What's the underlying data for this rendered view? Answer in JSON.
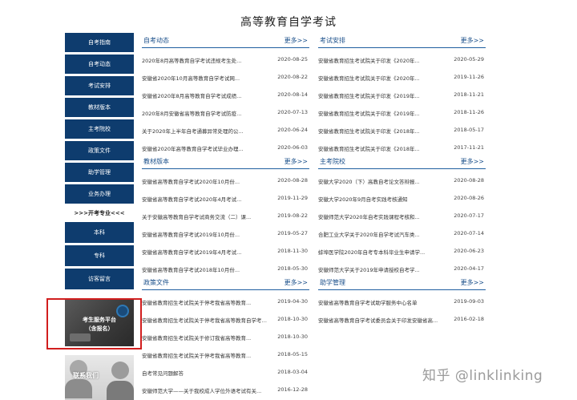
{
  "page": {
    "title": "高等教育自学考试"
  },
  "sidebar": {
    "items": [
      "自考指南",
      "自考动态",
      "考试安排",
      "教材版本",
      "主考院校",
      "政策文件",
      "助学管理",
      "业务办理"
    ],
    "heading": ">>>开考专业<<<",
    "items2": [
      "本科",
      "专科",
      "访客留言"
    ]
  },
  "promo": {
    "service_line1": "考生服务平台",
    "service_line2": "（含报名）",
    "contact": "联系我们"
  },
  "panels": {
    "dynamics": {
      "title": "自考动态",
      "more": "更多>>",
      "rows": [
        {
          "title": "2020年8月高等教育自学考试违规考生处...",
          "date": "2020-08-25"
        },
        {
          "title": "安徽省2020年10月高等教育自学考试网...",
          "date": "2020-08-22"
        },
        {
          "title": "安徽省2020年8月高等教育自学考试成绩...",
          "date": "2020-08-14"
        },
        {
          "title": "2020年8月安徽省高等教育自学考试防疫...",
          "date": "2020-07-13"
        },
        {
          "title": "关于2020年上半年自考通募异常处理的公...",
          "date": "2020-06-24"
        },
        {
          "title": "安徽省2020年高等教育自学考试毕业办理...",
          "date": "2020-06-03"
        }
      ]
    },
    "schedule": {
      "title": "考试安排",
      "more": "更多>>",
      "rows": [
        {
          "title": "安徽省教育招生考试院关于印发《2020年...",
          "date": "2020-05-29"
        },
        {
          "title": "安徽省教育招生考试院关于印发《2020年...",
          "date": "2019-11-26"
        },
        {
          "title": "安徽省教育招生考试院关于印发《2019年...",
          "date": "2018-11-21"
        },
        {
          "title": "安徽省教育招生考试院关于印发《2019年...",
          "date": "2018-11-26"
        },
        {
          "title": "安徽省教育招生考试院关于印发《2018年...",
          "date": "2018-05-17"
        },
        {
          "title": "安徽省教育招生考试院关于印发《2018年...",
          "date": "2017-11-21"
        }
      ]
    },
    "textbooks": {
      "title": "教材版本",
      "more": "更多>>",
      "rows": [
        {
          "title": "安徽省高等教育自学考试2020年10月份...",
          "date": "2020-08-28"
        },
        {
          "title": "安徽省高等教育自学考试2020年4月考试...",
          "date": "2019-11-29"
        },
        {
          "title": "关于安徽高等教育自学考试商务交流（二）课...",
          "date": "2019-08-22"
        },
        {
          "title": "安徽省高等教育自学考试2019年10月份...",
          "date": "2019-05-27"
        },
        {
          "title": "安徽省高等教育自学考试2019年4月考试...",
          "date": "2018-11-30"
        },
        {
          "title": "安徽省高等教育自学考试2018年10月份...",
          "date": "2018-05-30"
        }
      ]
    },
    "schools": {
      "title": "主考院校",
      "more": "更多>>",
      "rows": [
        {
          "title": "安徽大学2020（下）高教自考论文答辩报...",
          "date": "2020-08-28"
        },
        {
          "title": "安徽大学2020年9月自考实践考核通知",
          "date": "2020-08-26"
        },
        {
          "title": "安徽师范大学2020年自考实践课程考核和...",
          "date": "2020-07-17"
        },
        {
          "title": "合肥工业大学关于2020年自学考试汽车类...",
          "date": "2020-07-14"
        },
        {
          "title": "蚌埠医学院2020年自考专本科毕业生申请学...",
          "date": "2020-06-23"
        },
        {
          "title": "安徽师范大学关于2019年申请授校自考学...",
          "date": "2020-04-17"
        }
      ]
    },
    "policy": {
      "title": "政策文件",
      "more": "更多>>",
      "rows": [
        {
          "title": "安徽省教育招生考试院关于停考我省高等教育...",
          "date": "2019-04-30"
        },
        {
          "title": "安徽省教育招生考试院关于停考我省高等教育自学考试专业...",
          "date": "2018-10-30"
        },
        {
          "title": "安徽省教育招生考试院关于修订我省高等教育...",
          "date": "2018-10-30"
        },
        {
          "title": "安徽省教育招生考试院关于停考我省高等教育...",
          "date": "2018-05-15"
        },
        {
          "title": "自考常见问题解答",
          "date": "2018-03-04"
        },
        {
          "title": "安徽师范大学——关于我校成人学位外语考试有关...",
          "date": "2016-12-28"
        }
      ]
    },
    "assist": {
      "title": "助学管理",
      "more": "更多>>",
      "rows": [
        {
          "title": "安徽省高等教育自学考试助学服务中心名单",
          "date": "2019-09-03"
        },
        {
          "title": "安徽省高等教育自学考试委员会关于印发安徽省高...",
          "date": "2016-02-18"
        }
      ]
    }
  },
  "watermark": "知乎 @linklinking"
}
